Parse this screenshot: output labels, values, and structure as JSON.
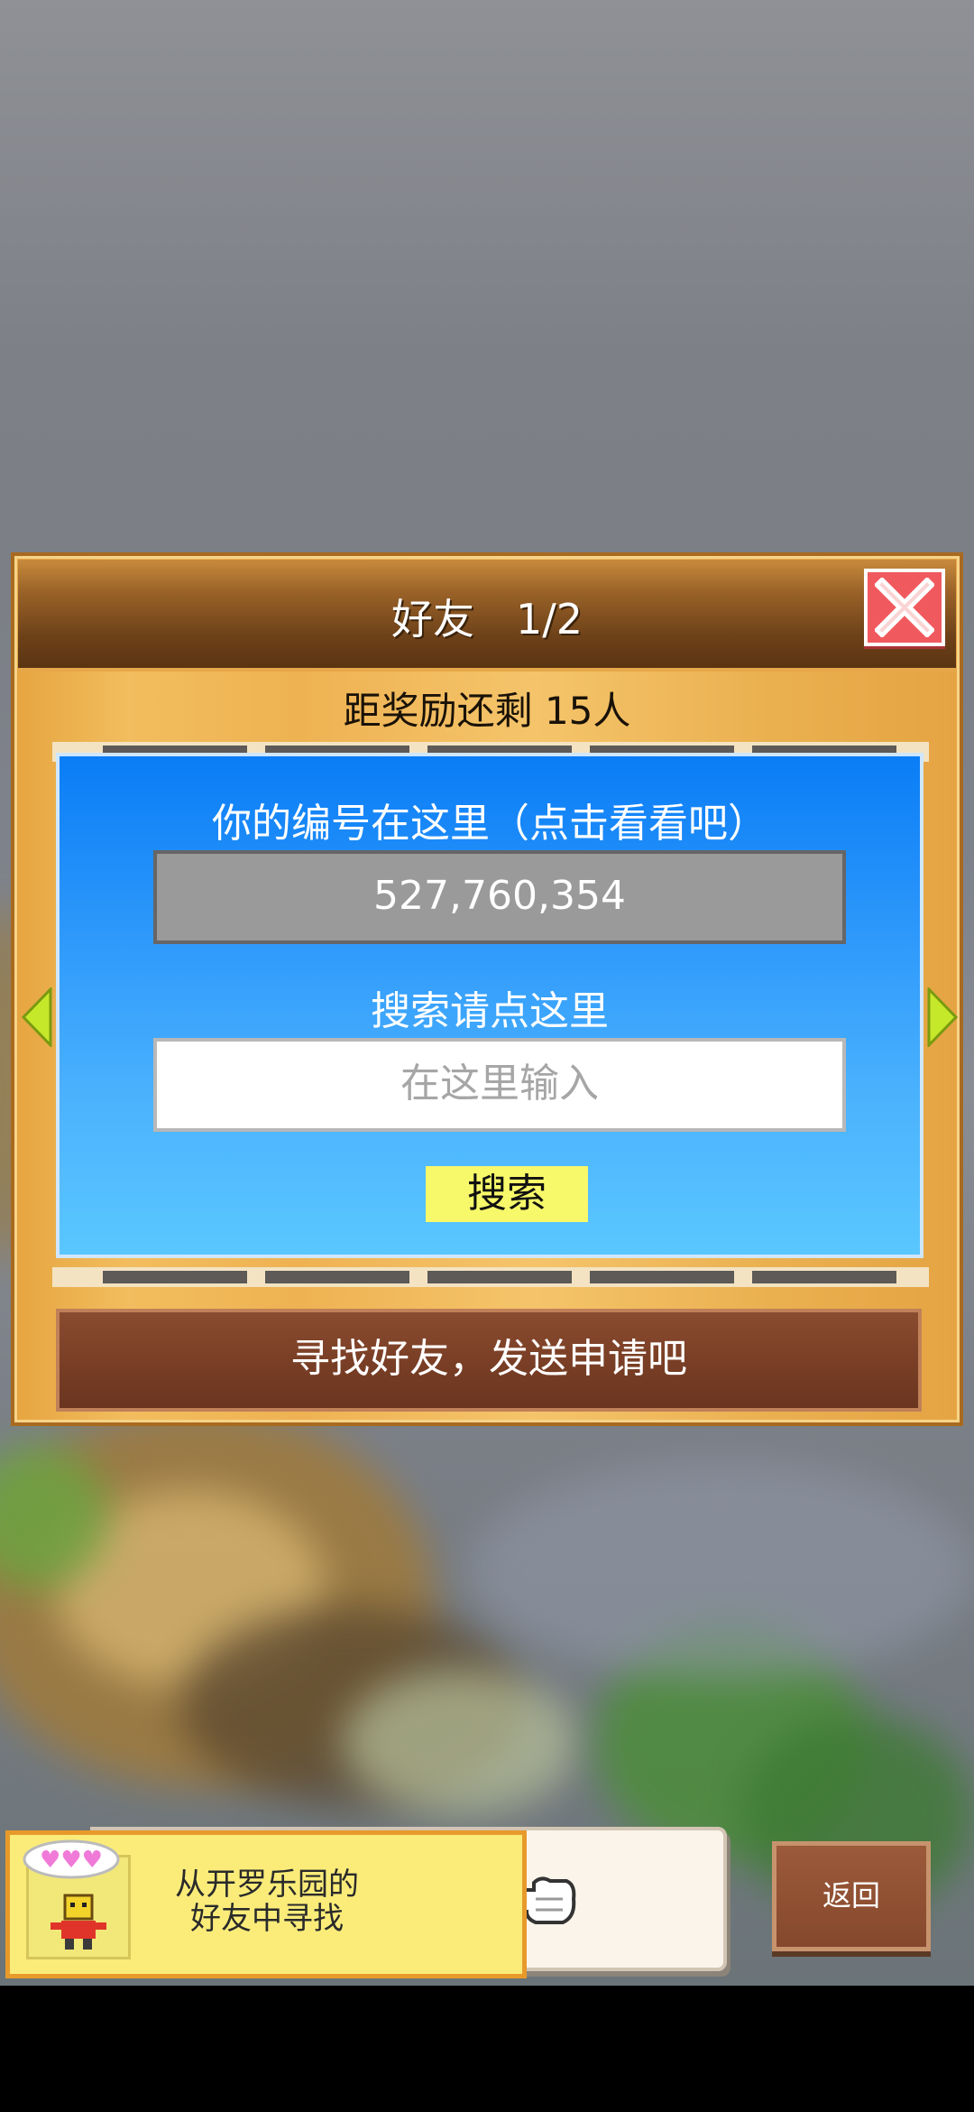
{
  "dialog": {
    "title": "好友　1/2",
    "reward_text": "距奖励还剩 15人",
    "panel": {
      "id_label": "你的编号在这里（点击看看吧）",
      "player_id": "527,760,354",
      "search_label": "搜索请点这里",
      "search_placeholder": "在这里输入",
      "search_button": "搜索"
    },
    "send_request_button": "寻找好友，发送申请吧"
  },
  "bottom": {
    "kairo_friends_text_line1": "从开罗乐园的",
    "kairo_friends_text_line2": "好友中寻找",
    "back_button": "返回"
  },
  "colors": {
    "panel_blue": "#0a7df6",
    "close_red": "#f05a5e",
    "search_yellow": "#f7f86a",
    "header_brown": "#6e4219"
  },
  "icons": [
    "close-icon",
    "arrow-left-icon",
    "arrow-right-icon",
    "hearts-icon",
    "kairo-character-icon",
    "pointing-hand-icon"
  ]
}
